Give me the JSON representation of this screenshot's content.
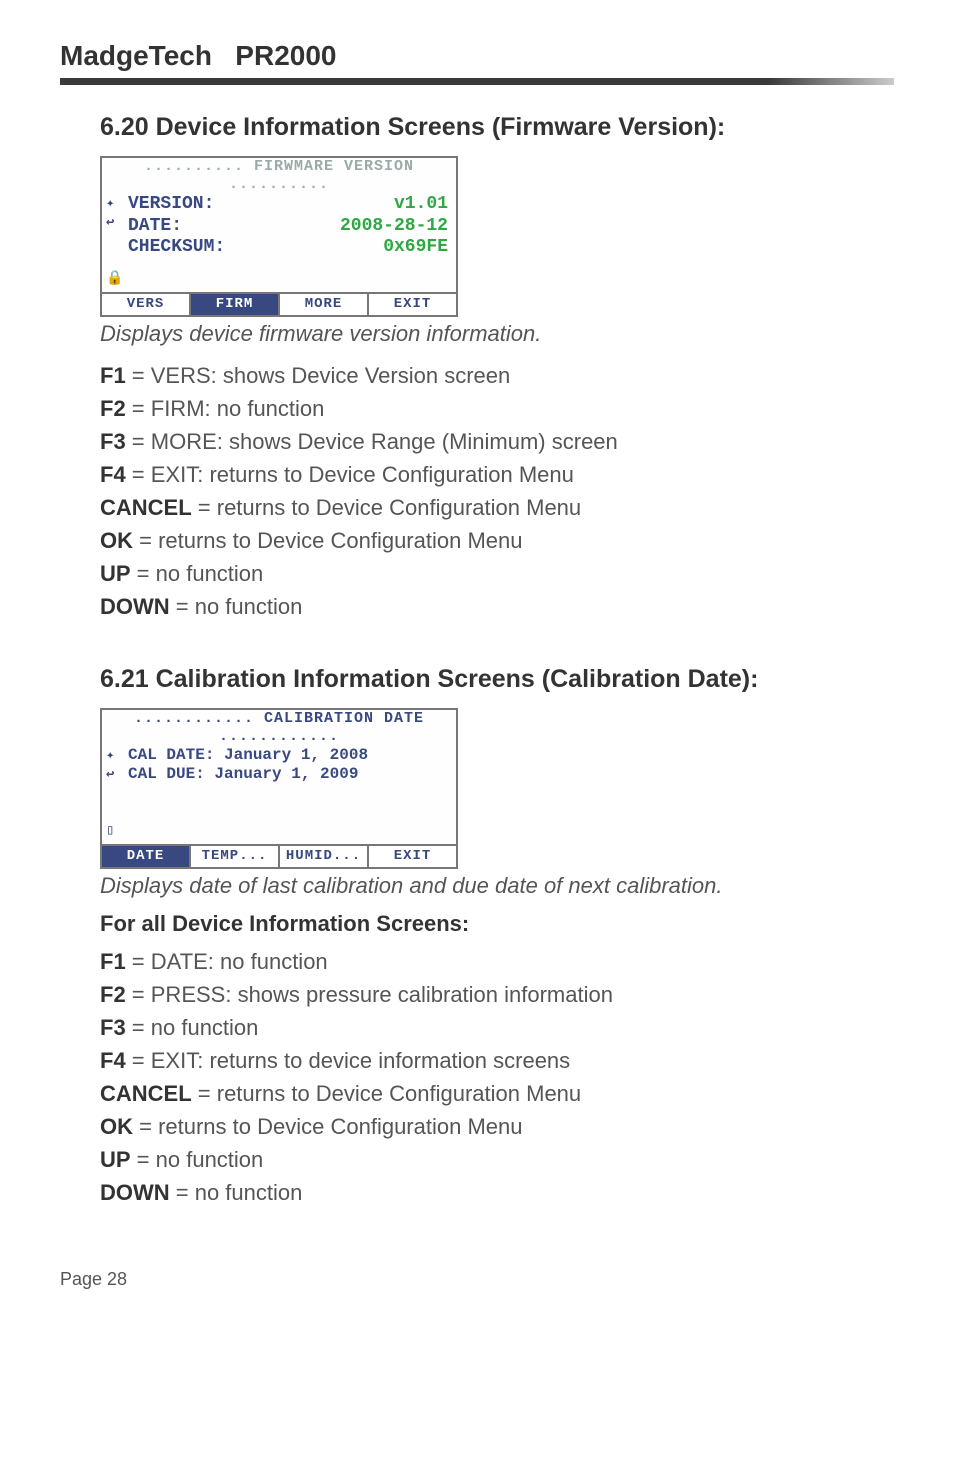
{
  "header": {
    "brand": "MadgeTech",
    "model": "PR2000"
  },
  "section1": {
    "heading": "6.20 Device Information Screens (Firmware Version):",
    "lcd": {
      "title": ".......... FIRWMARE VERSION ..........",
      "rows": [
        {
          "label": "VERSION:",
          "value": "v1.01"
        },
        {
          "label": "DATE:",
          "value": "2008-28-12"
        },
        {
          "label": "CHECKSUM:",
          "value": "0x69FE"
        }
      ],
      "tabs": [
        "VERS",
        "FIRM",
        "MORE",
        "EXIT"
      ],
      "activeTab": "FIRM"
    },
    "caption": "Displays device firmware version information.",
    "keys": [
      {
        "key": "F1",
        "desc": " = VERS: shows Device Version screen"
      },
      {
        "key": "F2",
        "desc": " = FIRM: no function"
      },
      {
        "key": "F3",
        "desc": " = MORE: shows Device Range (Minimum) screen"
      },
      {
        "key": "F4",
        "desc": " = EXIT: returns to Device Configuration Menu"
      },
      {
        "key": "CANCEL",
        "desc": " = returns to Device Configuration Menu"
      },
      {
        "key": "OK",
        "desc": " = returns to Device Configuration Menu"
      },
      {
        "key": "UP",
        "desc": " = no function"
      },
      {
        "key": "DOWN",
        "desc": " = no function"
      }
    ]
  },
  "section2": {
    "heading": "6.21 Calibration Information Screens (Calibration Date):",
    "lcd": {
      "title": "............ CALIBRATION DATE ............",
      "lines": [
        "CAL DATE: January 1, 2008",
        "CAL DUE: January 1, 2009"
      ],
      "tabs": [
        "DATE",
        "TEMP...",
        "HUMID...",
        "EXIT"
      ],
      "activeTab": "DATE"
    },
    "caption": "Displays date of last calibration and due date of next calibration.",
    "subheading": "For all Device Information Screens:",
    "keys": [
      {
        "key": "F1",
        "desc": " = DATE: no function"
      },
      {
        "key": "F2",
        "desc": " = PRESS: shows pressure calibration information"
      },
      {
        "key": "F3",
        "desc": " = no function"
      },
      {
        "key": "F4",
        "desc": " = EXIT: returns to device information screens"
      },
      {
        "key": "CANCEL",
        "desc": " = returns to Device Configuration Menu"
      },
      {
        "key": "OK",
        "desc": " = returns to Device Configuration Menu"
      },
      {
        "key": "UP",
        "desc": " = no function"
      },
      {
        "key": "DOWN",
        "desc": " = no function"
      }
    ]
  },
  "footer": {
    "page": "Page 28"
  }
}
